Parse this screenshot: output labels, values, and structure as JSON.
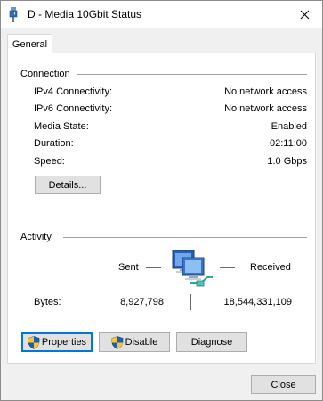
{
  "window": {
    "title": "D - Media 10Gbit Status"
  },
  "tabs": [
    {
      "label": "General"
    }
  ],
  "connection": {
    "group_label": "Connection",
    "rows": [
      {
        "label": "IPv4 Connectivity:",
        "value": "No network access"
      },
      {
        "label": "IPv6 Connectivity:",
        "value": "No network access"
      },
      {
        "label": "Media State:",
        "value": "Enabled"
      },
      {
        "label": "Duration:",
        "value": "02:11:00"
      },
      {
        "label": "Speed:",
        "value": "1.0 Gbps"
      }
    ],
    "details_button": "Details..."
  },
  "activity": {
    "group_label": "Activity",
    "sent_label": "Sent",
    "received_label": "Received",
    "bytes_label": "Bytes:",
    "bytes_sent": "8,927,798",
    "bytes_received": "18,544,331,109"
  },
  "actions": {
    "properties": "Properties",
    "disable": "Disable",
    "diagnose": "Diagnose"
  },
  "footer": {
    "close": "Close"
  },
  "icons": {
    "title": "network-adapter-icon",
    "shield": "uac-shield-icon",
    "activity": "network-computers-icon"
  },
  "colors": {
    "focus_border": "#0078d7",
    "shield_blue": "#1e5fb4",
    "shield_yellow": "#f6c635"
  }
}
